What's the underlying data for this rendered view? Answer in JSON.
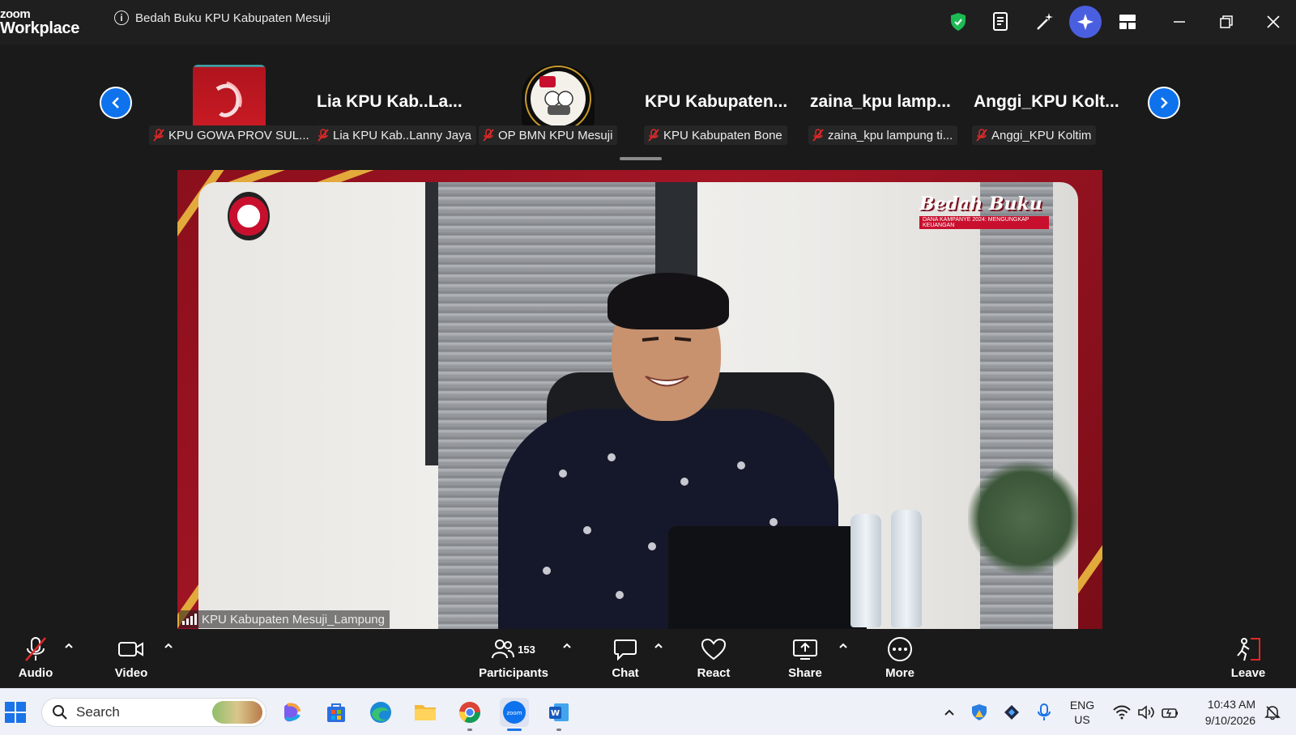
{
  "app": {
    "brand_top": "zoom",
    "brand_bottom": "Workplace",
    "meeting_title": "Bedah Buku KPU Kabupaten Mesuji"
  },
  "participants_strip": {
    "tiles": [
      {
        "big_name": "",
        "name": "KPU GOWA PROV SUL...",
        "muted": true
      },
      {
        "big_name": "Lia KPU Kab..La...",
        "name": "Lia KPU Kab..Lanny Jaya",
        "muted": true
      },
      {
        "big_name": "",
        "name": "OP BMN KPU Mesuji",
        "muted": true
      },
      {
        "big_name": "KPU Kabupaten...",
        "name": "KPU Kabupaten Bone",
        "muted": true
      },
      {
        "big_name": "zaina_kpu lamp...",
        "name": "zaina_kpu lampung ti...",
        "muted": true
      },
      {
        "big_name": "Anggi_KPU Kolt...",
        "name": "Anggi_KPU Koltim",
        "muted": true
      }
    ]
  },
  "main_video": {
    "speaker_name": "KPU Kabupaten Mesuji_Lampung",
    "event_logo_title": "Bedah Buku",
    "event_logo_subtitle": "DANA KAMPANYE 2024: MENGUNGKAP KEUANGAN"
  },
  "toolbar": {
    "audio": "Audio",
    "video": "Video",
    "participants": "Participants",
    "participants_count": "153",
    "chat": "Chat",
    "react": "React",
    "share": "Share",
    "more": "More",
    "leave": "Leave"
  },
  "taskbar": {
    "search_placeholder": "Search",
    "lang_top": "ENG",
    "lang_bottom": "US",
    "time": "10:43 AM",
    "date": "9/10/2026"
  },
  "colors": {
    "zoom_blue": "#0e72ed",
    "muted_red": "#e02828",
    "shield_green": "#1db954",
    "ai_purple": "#4a5fe0",
    "stage_red": "#a31525"
  }
}
